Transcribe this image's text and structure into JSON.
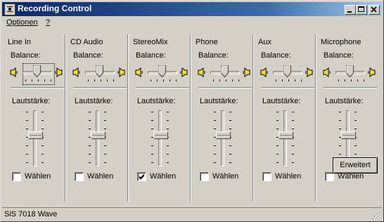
{
  "window": {
    "title": "Recording Control"
  },
  "menu": {
    "items": [
      "Optionen",
      "?"
    ]
  },
  "labels": {
    "balance": "Balance:",
    "volume": "Lautstärke:",
    "select": "Wählen"
  },
  "channels": [
    {
      "name": "Line In",
      "balance": 0.5,
      "volume": 0.55,
      "selected": false,
      "focused": true
    },
    {
      "name": "CD Audio",
      "balance": 0.5,
      "volume": 0.55,
      "selected": false,
      "focused": false
    },
    {
      "name": "StereoMix",
      "balance": 0.5,
      "volume": 0.55,
      "selected": true,
      "focused": false
    },
    {
      "name": "Phone",
      "balance": 0.5,
      "volume": 0.55,
      "selected": false,
      "focused": false
    },
    {
      "name": "Aux",
      "balance": 0.5,
      "volume": 0.55,
      "selected": false,
      "focused": false
    },
    {
      "name": "Microphone",
      "balance": 0.5,
      "volume": 0.55,
      "selected": false,
      "focused": false
    }
  ],
  "advanced_button": "Erweitert",
  "status": {
    "text": "SiS 7018 Wave"
  },
  "colors": {
    "title_start": "#0a246a",
    "title_end": "#a6caf0",
    "face": "#d4d0c8",
    "speaker": "#f0e040"
  }
}
